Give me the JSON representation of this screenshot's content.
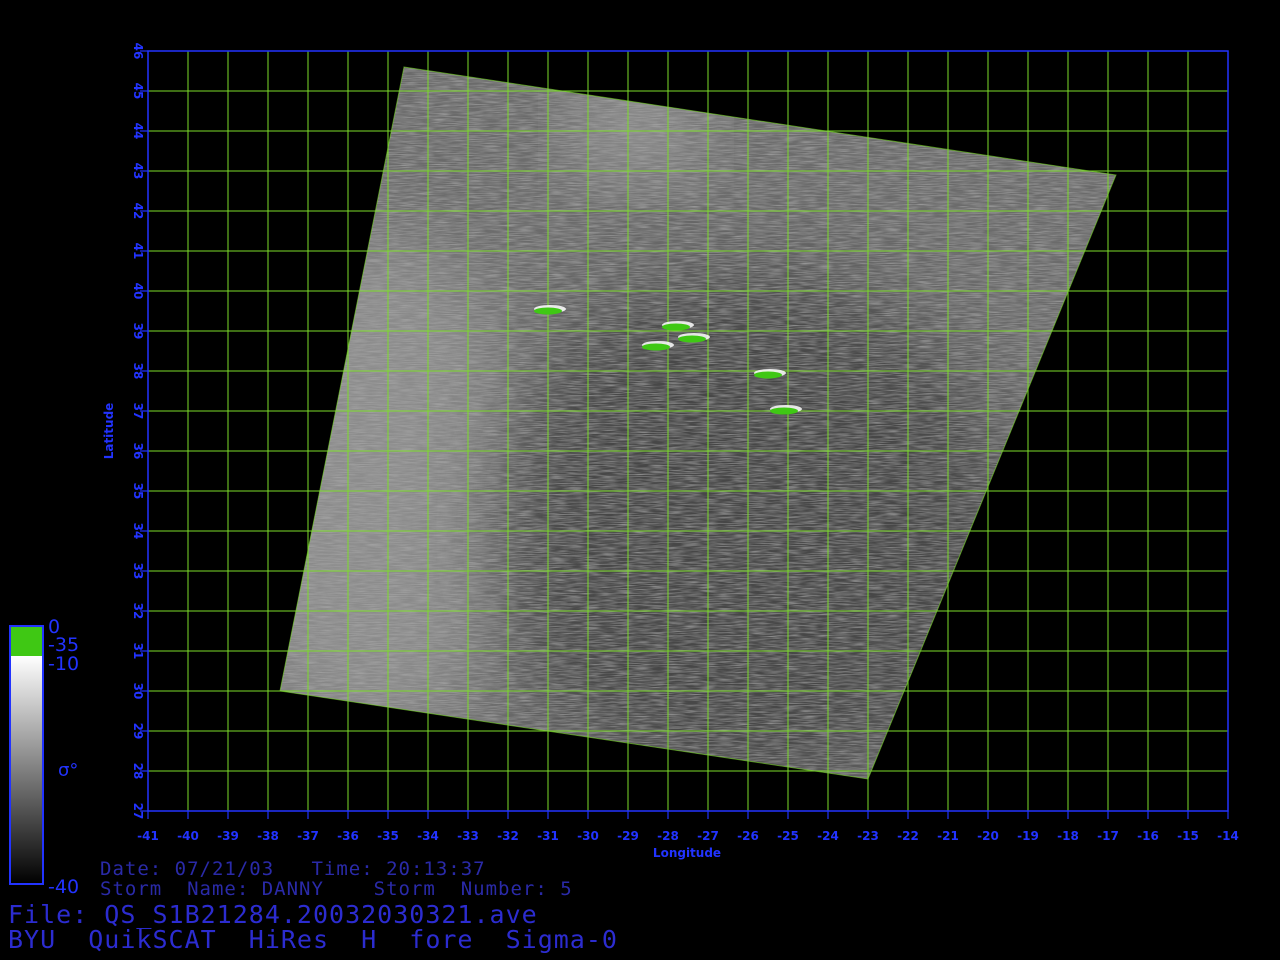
{
  "map": {
    "title_x": "Longitude",
    "title_y": "Latitude",
    "lon_ticks": [
      -41,
      -40,
      -39,
      -38,
      -37,
      -36,
      -35,
      -34,
      -33,
      -32,
      -31,
      -30,
      -29,
      -28,
      -27,
      -26,
      -25,
      -24,
      -23,
      -22,
      -21,
      -20,
      -19,
      -18,
      -17,
      -16,
      -15,
      -14
    ],
    "lat_ticks": [
      27,
      28,
      29,
      30,
      31,
      32,
      33,
      34,
      35,
      36,
      37,
      38,
      39,
      40,
      41,
      42,
      43,
      44,
      45,
      46
    ],
    "lon_range": [
      -41,
      -14
    ],
    "lat_range": [
      27,
      46
    ],
    "swath_corners_lonlat": [
      [
        -34.6,
        45.6
      ],
      [
        -16.8,
        42.9
      ],
      [
        -23.0,
        27.8
      ],
      [
        -37.7,
        30.0
      ]
    ],
    "bright_targets_lonlat": [
      [
        -31.0,
        39.5
      ],
      [
        -28.3,
        38.6
      ],
      [
        -27.4,
        38.8
      ],
      [
        -27.8,
        39.1
      ],
      [
        -25.5,
        37.9
      ],
      [
        -25.1,
        37.0
      ]
    ],
    "colors": {
      "axis": "#2233ff",
      "grid": "#7cdc2a",
      "swath": "#6b6b6b",
      "highlight": "#3fc814",
      "info_text": "#2a2aa8"
    }
  },
  "colorbar": {
    "labels": {
      "top": "0",
      "green_bottom": "-35",
      "white_top": "-10",
      "bottom": "-40"
    },
    "symbol": "σ°"
  },
  "info": {
    "date_line": "Date: 07/21/03   Time: 20:13:37",
    "storm_line": "Storm  Name: DANNY    Storm  Number: 5",
    "file_line": "File: QS_S1B21284.20032030321.ave",
    "title_line": "BYU  QuikSCAT  HiRes  H  fore  Sigma-0"
  }
}
